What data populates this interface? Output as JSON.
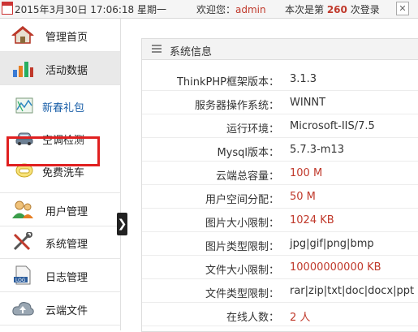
{
  "topbar": {
    "datetime": "2015年3月30日 17:06:18 星期一",
    "welcome_prefix": "欢迎您：",
    "username": "admin",
    "login_prefix": "本次是第 ",
    "login_count": "260",
    "login_suffix": " 次登录"
  },
  "sidebar": {
    "items": [
      {
        "label": "管理首页",
        "icon": "home-icon"
      },
      {
        "label": "活动数据",
        "icon": "bar-chart-icon"
      },
      {
        "label": "新春礼包",
        "icon": "map-icon"
      },
      {
        "label": "空调检测",
        "icon": "car-icon"
      },
      {
        "label": "免费洗车",
        "icon": "car-wash-icon"
      },
      {
        "label": "用户管理",
        "icon": "users-icon"
      },
      {
        "label": "系统管理",
        "icon": "tools-icon"
      },
      {
        "label": "日志管理",
        "icon": "log-icon"
      },
      {
        "label": "云端文件",
        "icon": "cloud-icon"
      }
    ],
    "collapse_glyph": "❯"
  },
  "panel": {
    "title": "系统信息",
    "rows": [
      {
        "key": "ThinkPHP框架版本：",
        "value": "3.1.3"
      },
      {
        "key": "服务器操作系统：",
        "value": "WINNT"
      },
      {
        "key": "运行环境：",
        "value": "Microsoft-IIS/7.5"
      },
      {
        "key": "Mysql版本：",
        "value": "5.7.3-m13"
      },
      {
        "key": "云端总容量：",
        "value": "100 M"
      },
      {
        "key": "用户空间分配：",
        "value": "50 M"
      },
      {
        "key": "图片大小限制：",
        "value": "1024 KB"
      },
      {
        "key": "图片类型限制：",
        "value": "jpg|gif|png|bmp"
      },
      {
        "key": "文件大小限制：",
        "value": "10000000000 KB"
      },
      {
        "key": "文件类型限制：",
        "value": "rar|zip|txt|doc|docx|ppt"
      },
      {
        "key": "在线人数：",
        "value": "2 人"
      }
    ]
  },
  "colors": {
    "accent_red": "#c0392b",
    "highlight_border": "#e02020"
  }
}
